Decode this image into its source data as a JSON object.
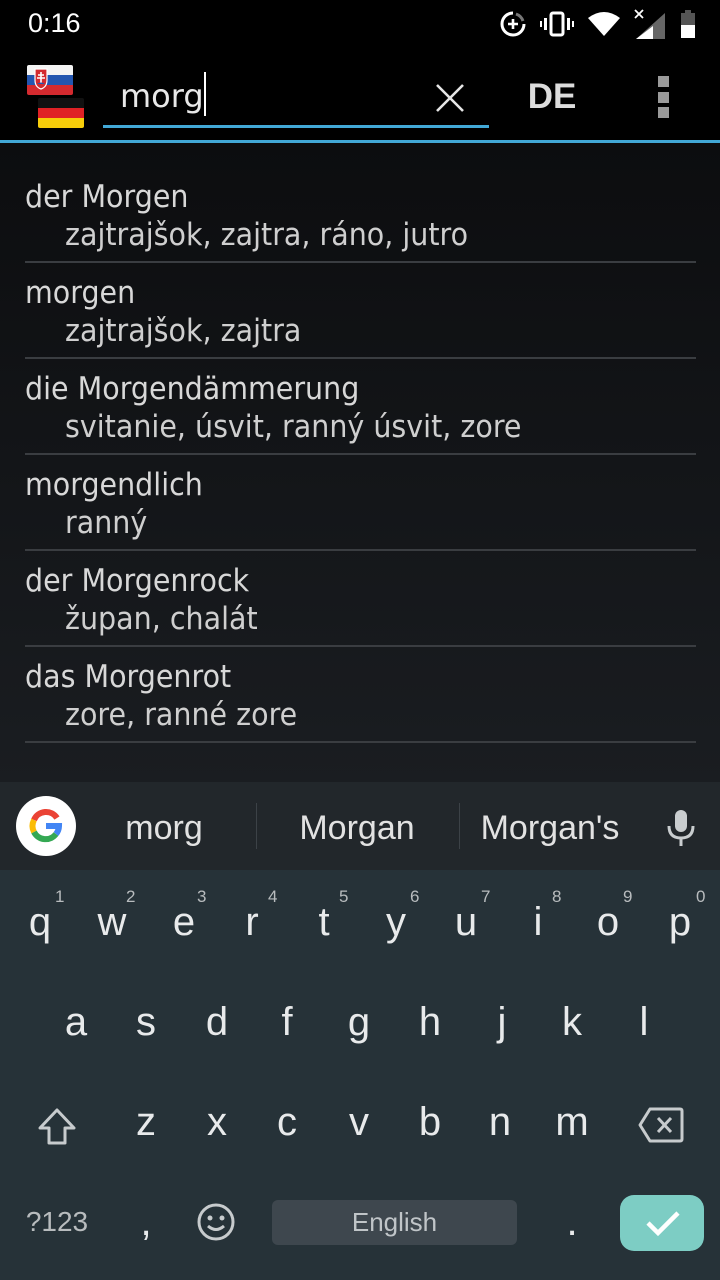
{
  "status_bar": {
    "time": "0:16",
    "icons": [
      "data-saver-icon",
      "vibrate-icon",
      "wifi-icon",
      "cell-signal-no-data-icon",
      "battery-icon"
    ]
  },
  "toolbar": {
    "source_flag": "slovak-flag",
    "target_flag": "german-flag",
    "search_value": "morg",
    "clear_icon": "close-icon",
    "language_label": "DE",
    "menu_icon": "more-vert-icon"
  },
  "colors": {
    "accent": "#42a8d6",
    "keyboard_bg": "#263238",
    "suggestion_bg": "#22272b",
    "enter_key": "#7dcdc4"
  },
  "results": [
    {
      "word": "der Morgen",
      "translation": "zajtrajšok, zajtra, ráno, jutro"
    },
    {
      "word": "morgen",
      "translation": "zajtrajšok, zajtra"
    },
    {
      "word": "die Morgendämmerung",
      "translation": "svitanie, úsvit, ranný úsvit, zore"
    },
    {
      "word": "morgendlich",
      "translation": "ranný"
    },
    {
      "word": "der Morgenrock",
      "translation": "župan, chalát"
    },
    {
      "word": "das Morgenrot",
      "translation": "zore, ranné zore"
    }
  ],
  "suggestions": {
    "items": [
      "morg",
      "Morgan",
      "Morgan's"
    ],
    "google_icon": "google-g-icon",
    "mic_icon": "mic-icon"
  },
  "keyboard": {
    "row1": [
      "q",
      "w",
      "e",
      "r",
      "t",
      "y",
      "u",
      "i",
      "o",
      "p"
    ],
    "row1_hints": [
      "1",
      "2",
      "3",
      "4",
      "5",
      "6",
      "7",
      "8",
      "9",
      "0"
    ],
    "row2": [
      "a",
      "s",
      "d",
      "f",
      "g",
      "h",
      "j",
      "k",
      "l"
    ],
    "row3": [
      "z",
      "x",
      "c",
      "v",
      "b",
      "n",
      "m"
    ],
    "shift_icon": "shift-icon",
    "backspace_icon": "backspace-icon",
    "symbols_label": "?123",
    "comma_label": ",",
    "emoji_icon": "emoji-icon",
    "space_label": "English",
    "period_label": ".",
    "enter_icon": "check-icon"
  }
}
